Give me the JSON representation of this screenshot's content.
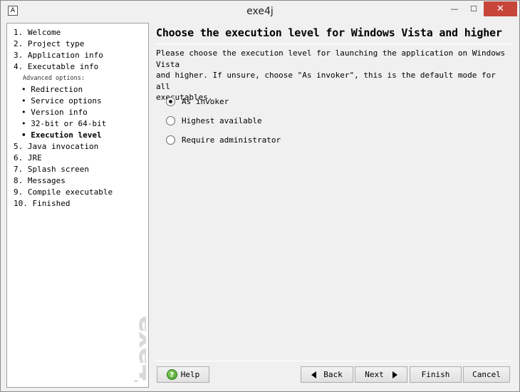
{
  "window": {
    "title": "exe4j",
    "app_icon_glyph": "A",
    "controls": {
      "minimize": "—",
      "maximize": "☐",
      "close": "✕"
    }
  },
  "sidebar": {
    "steps": [
      {
        "label": "1. Welcome"
      },
      {
        "label": "2. Project type"
      },
      {
        "label": "3. Application info"
      },
      {
        "label": "4. Executable info"
      },
      {
        "label": "Advanced options:"
      },
      {
        "label": "• Redirection"
      },
      {
        "label": "• Service options"
      },
      {
        "label": "• Version info"
      },
      {
        "label": "• 32-bit or 64-bit"
      },
      {
        "label": "• Execution level",
        "active": true
      },
      {
        "label": "5. Java invocation"
      },
      {
        "label": "6. JRE"
      },
      {
        "label": "7. Splash screen"
      },
      {
        "label": "8. Messages"
      },
      {
        "label": "9. Compile executable"
      },
      {
        "label": "10. Finished"
      }
    ],
    "watermark": "exe4j"
  },
  "content": {
    "heading": "Choose the execution level for Windows Vista and higher",
    "description_lines": [
      "Please choose the execution level for launching the application on Windows Vista",
      "and higher. If unsure, choose \"As invoker\", this is the default mode for all",
      "executables."
    ],
    "options": [
      {
        "label": "As invoker",
        "selected": true
      },
      {
        "label": "Highest available",
        "selected": false
      },
      {
        "label": "Require administrator",
        "selected": false
      }
    ]
  },
  "buttons": {
    "help": "Help",
    "back": "Back",
    "next": "Next",
    "finish": "Finish",
    "cancel": "Cancel"
  },
  "colors": {
    "close_button": "#c7463a",
    "help_icon": "#3f9a25",
    "watermark": "#d9d9d9"
  }
}
